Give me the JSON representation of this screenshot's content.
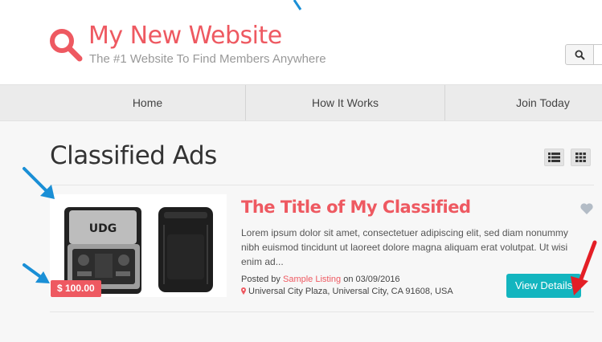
{
  "header": {
    "title": "My New Website",
    "tagline": "The #1 Website To Find Members Anywhere"
  },
  "nav": {
    "items": [
      {
        "label": "Home"
      },
      {
        "label": "How It Works"
      },
      {
        "label": "Join Today"
      }
    ]
  },
  "main": {
    "page_title": "Classified Ads",
    "listing": {
      "price": "$ 100.00",
      "title": "The Title of My Classified",
      "description": "Lorem ipsum dolor sit amet, consectetuer adipiscing elit, sed diam nonummy nibh euismod tincidunt ut laoreet dolore magna aliquam erat volutpat. Ut wisi enim ad...",
      "posted_by_prefix": "Posted by",
      "posted_by_name": "Sample Listing",
      "posted_on": "on 03/09/2016",
      "location": "Universal City Plaza, Universal City, CA 91608, USA",
      "details_button": "View Details",
      "image_label": "UDG"
    }
  },
  "icons": {
    "logo": "search-icon",
    "search_button": "search-icon",
    "list_view": "list-view-icon",
    "grid_view": "grid-view-icon",
    "favorite": "heart-icon",
    "location": "map-pin-icon"
  },
  "colors": {
    "brand": "#ee5961",
    "button": "#13b5bf",
    "annotation_blue": "#1a8fd6",
    "annotation_red": "#e41f26"
  }
}
